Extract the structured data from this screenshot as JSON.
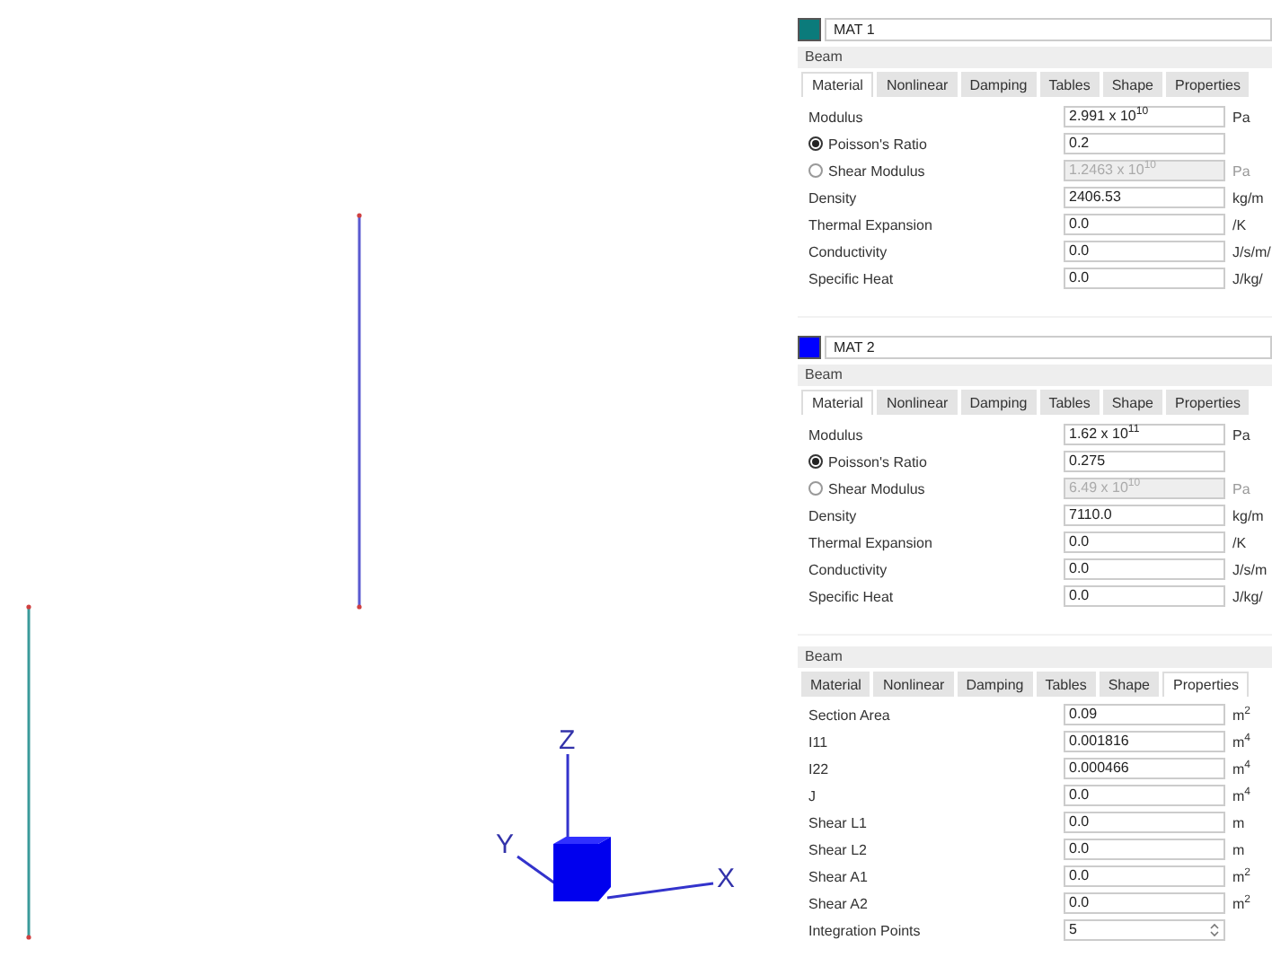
{
  "viewport": {
    "axes": {
      "x": "X",
      "y": "Y",
      "z": "Z"
    }
  },
  "materials": [
    {
      "name": "MAT 1",
      "color": "#0b7b7b",
      "group": "Beam",
      "tabs": [
        {
          "label": "Material",
          "selected": true
        },
        {
          "label": "Nonlinear",
          "selected": false
        },
        {
          "label": "Damping",
          "selected": false
        },
        {
          "label": "Tables",
          "selected": false
        },
        {
          "label": "Shape",
          "selected": false
        },
        {
          "label": "Properties",
          "selected": false
        }
      ],
      "rows": [
        {
          "kind": "plain",
          "label": "Modulus",
          "value": "2.991 x 10$^{10}$",
          "unit": "Pa",
          "disabled": false
        },
        {
          "kind": "radio",
          "label": "Poisson's Ratio",
          "selected": true,
          "value": "0.2",
          "disabled": false
        },
        {
          "kind": "radio",
          "label": "Shear Modulus",
          "selected": false,
          "value": "1.2463 x 10$^{10}$",
          "unit": "Pa",
          "disabled": true
        },
        {
          "kind": "plain",
          "label": "Density",
          "value": "2406.53",
          "unit": "kg/m",
          "disabled": false
        },
        {
          "kind": "plain",
          "label": "Thermal Expansion",
          "value": "0.0",
          "unit": "/K",
          "disabled": false
        },
        {
          "kind": "plain",
          "label": "Conductivity",
          "value": "0.0",
          "unit": "J/s/m/",
          "disabled": false
        },
        {
          "kind": "plain",
          "label": "Specific Heat",
          "value": "0.0",
          "unit": "J/kg/",
          "disabled": false
        }
      ]
    },
    {
      "name": "MAT 2",
      "color": "#0000ff",
      "group": "Beam",
      "tabs": [
        {
          "label": "Material",
          "selected": true
        },
        {
          "label": "Nonlinear",
          "selected": false
        },
        {
          "label": "Damping",
          "selected": false
        },
        {
          "label": "Tables",
          "selected": false
        },
        {
          "label": "Shape",
          "selected": false
        },
        {
          "label": "Properties",
          "selected": false
        }
      ],
      "rows": [
        {
          "kind": "plain",
          "label": "Modulus",
          "value": "1.62 x 10$^{11}$",
          "unit": "Pa",
          "disabled": false
        },
        {
          "kind": "radio",
          "label": "Poisson's Ratio",
          "selected": true,
          "value": "0.275",
          "disabled": false
        },
        {
          "kind": "radio",
          "label": "Shear Modulus",
          "selected": false,
          "value": "6.49 x 10$^{10}$",
          "unit": "Pa",
          "disabled": true
        },
        {
          "kind": "plain",
          "label": "Density",
          "value": "7110.0",
          "unit": "kg/m",
          "disabled": false
        },
        {
          "kind": "plain",
          "label": "Thermal Expansion",
          "value": "0.0",
          "unit": "/K",
          "disabled": false
        },
        {
          "kind": "plain",
          "label": "Conductivity",
          "value": "0.0",
          "unit": "J/s/m",
          "disabled": false
        },
        {
          "kind": "plain",
          "label": "Specific Heat",
          "value": "0.0",
          "unit": "J/kg/",
          "disabled": false
        }
      ]
    }
  ],
  "section": {
    "group": "Beam",
    "tabs": [
      {
        "label": "Material",
        "selected": false
      },
      {
        "label": "Nonlinear",
        "selected": false
      },
      {
        "label": "Damping",
        "selected": false
      },
      {
        "label": "Tables",
        "selected": false
      },
      {
        "label": "Shape",
        "selected": false
      },
      {
        "label": "Properties",
        "selected": true
      }
    ],
    "rows": [
      {
        "kind": "plain",
        "label": "Section Area",
        "value": "0.09",
        "unit": "m$^{2}$"
      },
      {
        "kind": "plain",
        "label": "I11",
        "value": "0.001816",
        "unit": "m$^{4}$"
      },
      {
        "kind": "plain",
        "label": "I22",
        "value": "0.000466",
        "unit": "m$^{4}$"
      },
      {
        "kind": "plain",
        "label": "J",
        "value": "0.0",
        "unit": "m$^{4}$"
      },
      {
        "kind": "plain",
        "label": "Shear L1",
        "value": "0.0",
        "unit": "m"
      },
      {
        "kind": "plain",
        "label": "Shear L2",
        "value": "0.0",
        "unit": "m"
      },
      {
        "kind": "plain",
        "label": "Shear A1",
        "value": "0.0",
        "unit": "m$^{2}$"
      },
      {
        "kind": "plain",
        "label": "Shear A2",
        "value": "0.0",
        "unit": "m$^{2}$"
      },
      {
        "kind": "spin",
        "label": "Integration Points",
        "value": "5"
      }
    ]
  }
}
